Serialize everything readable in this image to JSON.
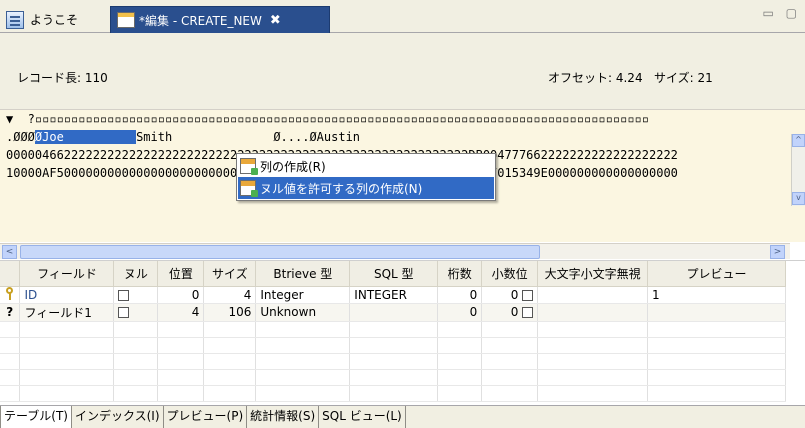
{
  "tabs": [
    {
      "label": "ようこそ",
      "icon": "document-icon"
    },
    {
      "label": "*編集 - CREATE_NEW",
      "icon": "table-edit-icon",
      "close": "✖"
    }
  ],
  "tab_controls": "▭ ▢",
  "info": {
    "record_length": "レコード長: 110",
    "offset": "オフセット: 4.24",
    "size": "サイズ: 21"
  },
  "hex": {
    "ruler_marker": "▼",
    "ruler": "  ?▫▫▫▫▫▫▫▫▫▫▫▫▫▫▫▫▫▫▫▫▫▫▫▫▫▫▫▫▫▫▫▫▫▫▫▫▫▫▫▫▫▫▫▫▫▫▫▫▫▫▫▫▫▫▫▫▫▫▫▫▫▫▫▫▫▫▫▫▫▫▫▫▫▫▫▫▫▫▫▫▫▫▫▫▫",
    "data_prefix": ".ØØØ",
    "data_selected": "ØJoe          ",
    "data_rest": "Smith              Ø....ØAustin",
    "hi_line": "0000046622222222222222222222222222222222222222222222222222222222DB004777662222222222222222222",
    "lo_line": "10000AF5000000000000000000000000000000000000000000000000000000000967015349E000000000000000000"
  },
  "context_menu": [
    {
      "label": "列の作成(R)",
      "icon": "create-column-icon"
    },
    {
      "label": "ヌル値を許可する列の作成(N)",
      "icon": "create-nullable-column-icon"
    }
  ],
  "grid": {
    "headers": [
      "",
      "フィールド",
      "ヌル",
      "位置",
      "サイズ",
      "Btrieve 型",
      "SQL 型",
      "桁数",
      "小数位",
      "大文字小文字無視",
      "プレビュー"
    ],
    "rows": [
      {
        "marker": "key",
        "field": "ID",
        "position": "0",
        "size": "4",
        "btrieve": "Integer",
        "sql": "INTEGER",
        "digits": "0",
        "decimals": "0",
        "preview": "1"
      },
      {
        "marker": "?",
        "field": "フィールド1",
        "position": "4",
        "size": "106",
        "btrieve": "Unknown",
        "sql": "",
        "digits": "0",
        "decimals": "0",
        "preview": ""
      }
    ]
  },
  "bottom_tabs": [
    "テーブル(T)",
    "インデックス(I)",
    "プレビュー(P)",
    "統計情報(S)",
    "SQL ビュー(L)"
  ],
  "scroll": {
    "left": "<",
    "right": ">",
    "up": "^",
    "down": "v",
    "grip": "|||"
  }
}
